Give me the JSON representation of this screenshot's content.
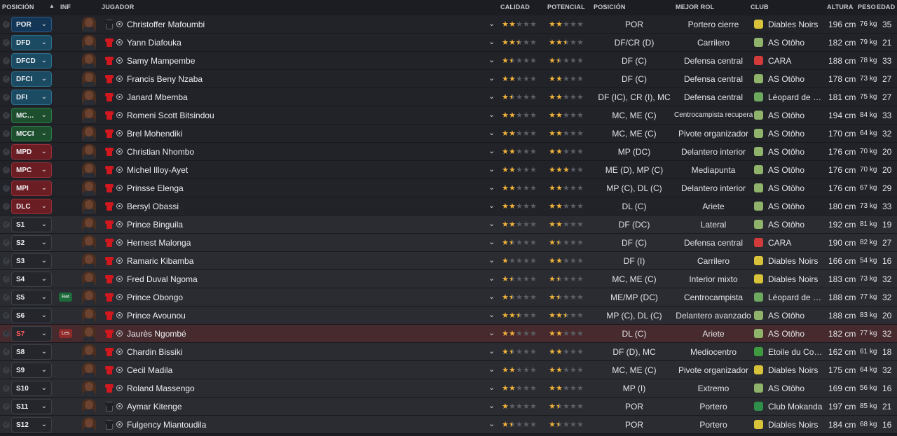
{
  "headers": {
    "posicion": "POSICIÓN",
    "inf": "INF",
    "jugador": "JUGADOR",
    "calidad": "CALIDAD",
    "potencial": "POTENCIAL",
    "posicion2": "POSICIÓN",
    "mejor_rol": "MEJOR ROL",
    "club": "CLUB",
    "altura": "ALTURA",
    "peso": "PESO",
    "edad": "EDAD"
  },
  "colors": {
    "por": "#143656",
    "def": "#1b4a63",
    "mid": "#1d4f2f",
    "att": "#6a1d23",
    "star_full": "#f2b33a",
    "injured_row": "#472a2e"
  },
  "rows": [
    {
      "slot": "POR",
      "slot_group": "por",
      "inf": "",
      "kit": "gk",
      "name": "Christoffer Mafoumbi",
      "ca": 2,
      "pa": 2,
      "position": "POR",
      "role": "Portero cierre",
      "club": "Diables Noirs",
      "club_icon": "diables-noirs-crest",
      "height": "196 cm",
      "weight": "76 kg",
      "age": "35"
    },
    {
      "slot": "DFD",
      "slot_group": "def",
      "inf": "",
      "kit": "outfield",
      "name": "Yann Diafouka",
      "ca": 2.5,
      "pa": 2.5,
      "position": "DF/CR (D)",
      "role": "Carrilero",
      "club": "AS Otôho",
      "club_icon": "as-otoho-crest",
      "height": "182 cm",
      "weight": "79 kg",
      "age": "21"
    },
    {
      "slot": "DFCD",
      "slot_group": "def",
      "inf": "",
      "kit": "outfield",
      "name": "Samy Mampembe",
      "ca": 1.5,
      "pa": 1.5,
      "position": "DF (C)",
      "role": "Defensa central",
      "club": "CARA",
      "club_icon": "cara-crest",
      "height": "188 cm",
      "weight": "78 kg",
      "age": "33"
    },
    {
      "slot": "DFCI",
      "slot_group": "def",
      "inf": "",
      "kit": "outfield",
      "name": "Francis Beny Nzaba",
      "ca": 2,
      "pa": 2,
      "position": "DF (C)",
      "role": "Defensa central",
      "club": "AS Otôho",
      "club_icon": "as-otoho-crest",
      "height": "178 cm",
      "weight": "73 kg",
      "age": "27"
    },
    {
      "slot": "DFI",
      "slot_group": "def",
      "inf": "",
      "kit": "outfield",
      "name": "Janard Mbemba",
      "ca": 1.5,
      "pa": 2,
      "position": "DF (IC), CR (I), MC",
      "role": "Defensa central",
      "club": "Léopard de Dolisie",
      "club_icon": "leopard-crest",
      "height": "181 cm",
      "weight": "75 kg",
      "age": "27"
    },
    {
      "slot": "MC…",
      "slot_group": "mid",
      "inf": "",
      "kit": "outfield",
      "name": "Romeni Scott Bitsindou",
      "ca": 2,
      "pa": 2,
      "position": "MC, ME (C)",
      "role": "Centrocampista recuperador",
      "role_small": true,
      "club": "AS Otôho",
      "club_icon": "as-otoho-crest",
      "height": "194 cm",
      "weight": "84 kg",
      "age": "33"
    },
    {
      "slot": "MCCI",
      "slot_group": "mid",
      "inf": "",
      "kit": "outfield",
      "name": "Brel Mohendiki",
      "ca": 2,
      "pa": 2,
      "position": "MC, ME (C)",
      "role": "Pivote organizador",
      "club": "AS Otôho",
      "club_icon": "as-otoho-crest",
      "height": "170 cm",
      "weight": "64 kg",
      "age": "32"
    },
    {
      "slot": "MPD",
      "slot_group": "att",
      "inf": "",
      "kit": "outfield",
      "name": "Christian Nhombo",
      "ca": 2,
      "pa": 2,
      "position": "MP (DC)",
      "role": "Delantero interior",
      "club": "AS Otôho",
      "club_icon": "as-otoho-crest",
      "height": "176 cm",
      "weight": "70 kg",
      "age": "20"
    },
    {
      "slot": "MPC",
      "slot_group": "att",
      "inf": "",
      "kit": "outfield",
      "name": "Michel Illoy-Ayet",
      "ca": 2,
      "pa": 3,
      "position": "ME (D), MP (C)",
      "role": "Mediapunta",
      "club": "AS Otôho",
      "club_icon": "as-otoho-crest",
      "height": "176 cm",
      "weight": "70 kg",
      "age": "20"
    },
    {
      "slot": "MPI",
      "slot_group": "att",
      "inf": "",
      "kit": "outfield",
      "name": "Prinsse Elenga",
      "ca": 2,
      "pa": 2,
      "position": "MP (C), DL (C)",
      "role": "Delantero interior",
      "club": "AS Otôho",
      "club_icon": "as-otoho-crest",
      "height": "176 cm",
      "weight": "67 kg",
      "age": "29"
    },
    {
      "slot": "DLC",
      "slot_group": "att",
      "inf": "",
      "kit": "outfield",
      "name": "Bersyl Obassi",
      "ca": 2,
      "pa": 2,
      "position": "DL (C)",
      "role": "Ariete",
      "club": "AS Otôho",
      "club_icon": "as-otoho-crest",
      "height": "180 cm",
      "weight": "73 kg",
      "age": "33"
    },
    {
      "slot": "S1",
      "slot_group": "sub",
      "inf": "",
      "kit": "outfield",
      "name": "Prince Binguila",
      "ca": 2,
      "pa": 2,
      "position": "DF (DC)",
      "role": "Lateral",
      "club": "AS Otôho",
      "club_icon": "as-otoho-crest",
      "height": "192 cm",
      "weight": "81 kg",
      "age": "19"
    },
    {
      "slot": "S2",
      "slot_group": "sub",
      "inf": "",
      "kit": "outfield",
      "name": "Hernest Malonga",
      "ca": 1.5,
      "pa": 1.5,
      "position": "DF (C)",
      "role": "Defensa central",
      "club": "CARA",
      "club_icon": "cara-crest",
      "height": "190 cm",
      "weight": "82 kg",
      "age": "27"
    },
    {
      "slot": "S3",
      "slot_group": "sub",
      "inf": "",
      "kit": "outfield",
      "name": "Ramaric Kibamba",
      "ca": 1,
      "pa": 2,
      "position": "DF (I)",
      "role": "Carrilero",
      "club": "Diables Noirs",
      "club_icon": "diables-noirs-crest",
      "height": "166 cm",
      "weight": "54 kg",
      "age": "16"
    },
    {
      "slot": "S4",
      "slot_group": "sub",
      "inf": "",
      "kit": "outfield",
      "name": "Fred Duval Ngoma",
      "ca": 1.5,
      "pa": 1.5,
      "position": "MC, ME (C)",
      "role": "Interior mixto",
      "club": "Diables Noirs",
      "club_icon": "diables-noirs-crest",
      "height": "183 cm",
      "weight": "73 kg",
      "age": "32"
    },
    {
      "slot": "S5",
      "slot_group": "sub",
      "inf": "Ret",
      "inf_type": "ret",
      "kit": "outfield",
      "name": "Prince Obongo",
      "ca": 1.5,
      "pa": 1.5,
      "position": "ME/MP (DC)",
      "role": "Centrocampista",
      "club": "Léopard de Dolisie",
      "club_icon": "leopard-crest",
      "height": "188 cm",
      "weight": "77 kg",
      "age": "32"
    },
    {
      "slot": "S6",
      "slot_group": "sub",
      "inf": "",
      "kit": "outfield",
      "name": "Prince Avounou",
      "ca": 2.5,
      "pa": 2.5,
      "position": "MP (C), DL (C)",
      "role": "Delantero avanzado",
      "club": "AS Otôho",
      "club_icon": "as-otoho-crest",
      "height": "188 cm",
      "weight": "83 kg",
      "age": "20"
    },
    {
      "slot": "S7",
      "slot_group": "sub-injured",
      "inf": "Les",
      "inf_type": "les",
      "kit": "outfield",
      "name": "Jaurès Ngombé",
      "ca": 2,
      "pa": 2,
      "position": "DL (C)",
      "role": "Ariete",
      "club": "AS Otôho",
      "club_icon": "as-otoho-crest",
      "height": "182 cm",
      "weight": "77 kg",
      "age": "32"
    },
    {
      "slot": "S8",
      "slot_group": "sub",
      "inf": "",
      "kit": "outfield",
      "name": "Chardin Bissiki",
      "ca": 1.5,
      "pa": 2,
      "position": "DF (D), MC",
      "role": "Mediocentro",
      "club": "Etoile du Congo",
      "club_icon": "etoile-crest",
      "height": "162 cm",
      "weight": "61 kg",
      "age": "18"
    },
    {
      "slot": "S9",
      "slot_group": "sub",
      "inf": "",
      "kit": "outfield",
      "name": "Cecil Madila",
      "ca": 2,
      "pa": 2,
      "position": "MC, ME (C)",
      "role": "Pivote organizador",
      "club": "Diables Noirs",
      "club_icon": "diables-noirs-crest",
      "height": "175 cm",
      "weight": "64 kg",
      "age": "32"
    },
    {
      "slot": "S10",
      "slot_group": "sub",
      "inf": "",
      "kit": "outfield",
      "name": "Roland Massengo",
      "ca": 2,
      "pa": 2,
      "position": "MP (I)",
      "role": "Extremo",
      "club": "AS Otôho",
      "club_icon": "as-otoho-crest",
      "height": "169 cm",
      "weight": "56 kg",
      "age": "16"
    },
    {
      "slot": "S11",
      "slot_group": "sub",
      "inf": "",
      "kit": "gk",
      "name": "Aymar Kitenge",
      "ca": 1,
      "pa": 1.5,
      "position": "POR",
      "role": "Portero",
      "club": "Club Mokanda",
      "club_icon": "mokanda-crest",
      "height": "197 cm",
      "weight": "85 kg",
      "age": "21"
    },
    {
      "slot": "S12",
      "slot_group": "sub",
      "inf": "",
      "kit": "gk",
      "name": "Fulgency Miantoudila",
      "ca": 1.5,
      "pa": 1.5,
      "position": "POR",
      "role": "Portero",
      "club": "Diables Noirs",
      "club_icon": "diables-noirs-crest",
      "height": "184 cm",
      "weight": "68 kg",
      "age": "16"
    }
  ]
}
